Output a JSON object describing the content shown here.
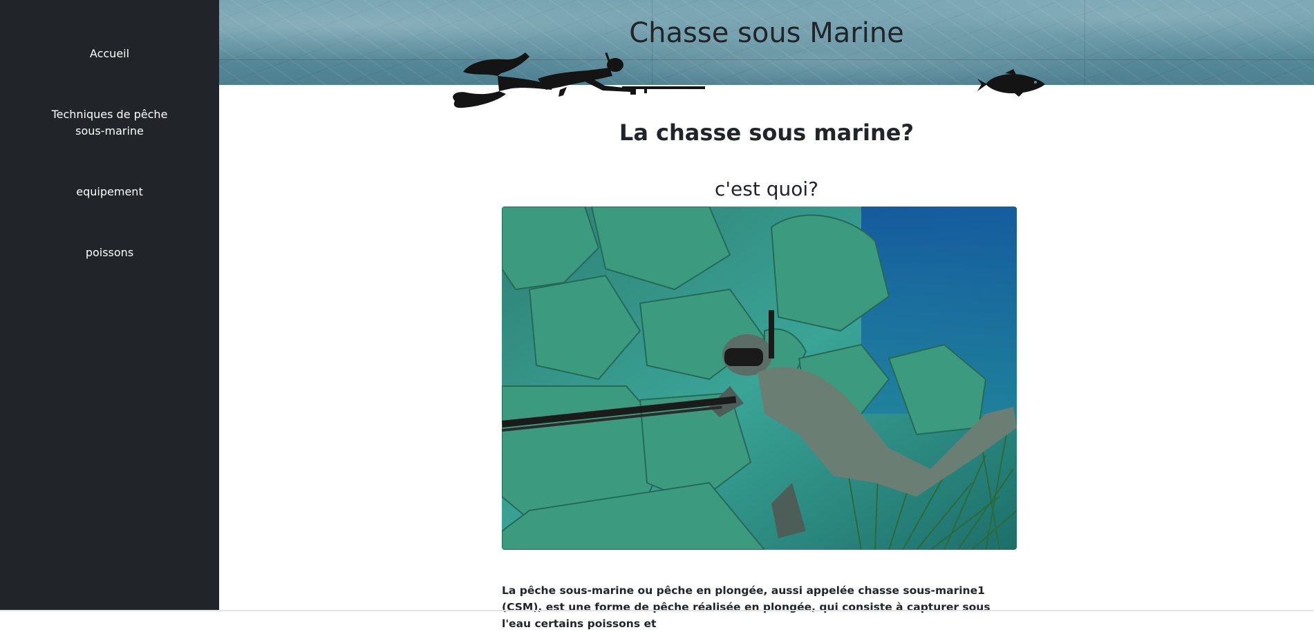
{
  "sidebar": {
    "items": [
      {
        "label": "Accueil"
      },
      {
        "label": "Techniques de pêche sous-marine"
      },
      {
        "label": "equipement"
      },
      {
        "label": "poissons"
      }
    ]
  },
  "header": {
    "title": "Chasse sous Marine"
  },
  "main": {
    "heading": "La chasse sous marine?",
    "subheading": "c'est quoi?",
    "photo_icon": "spearfishing-diver-photo",
    "paragraph": "La pêche sous-marine ou pêche en plongée, aussi appelée chasse sous-marine1 (CSM), est une forme de pêche réalisée en plongée, qui consiste à capturer sous l'eau certains poissons et"
  },
  "colors": {
    "sidebar_bg": "#212529",
    "header_bg": "#5a8d9d",
    "text": "#212529"
  }
}
